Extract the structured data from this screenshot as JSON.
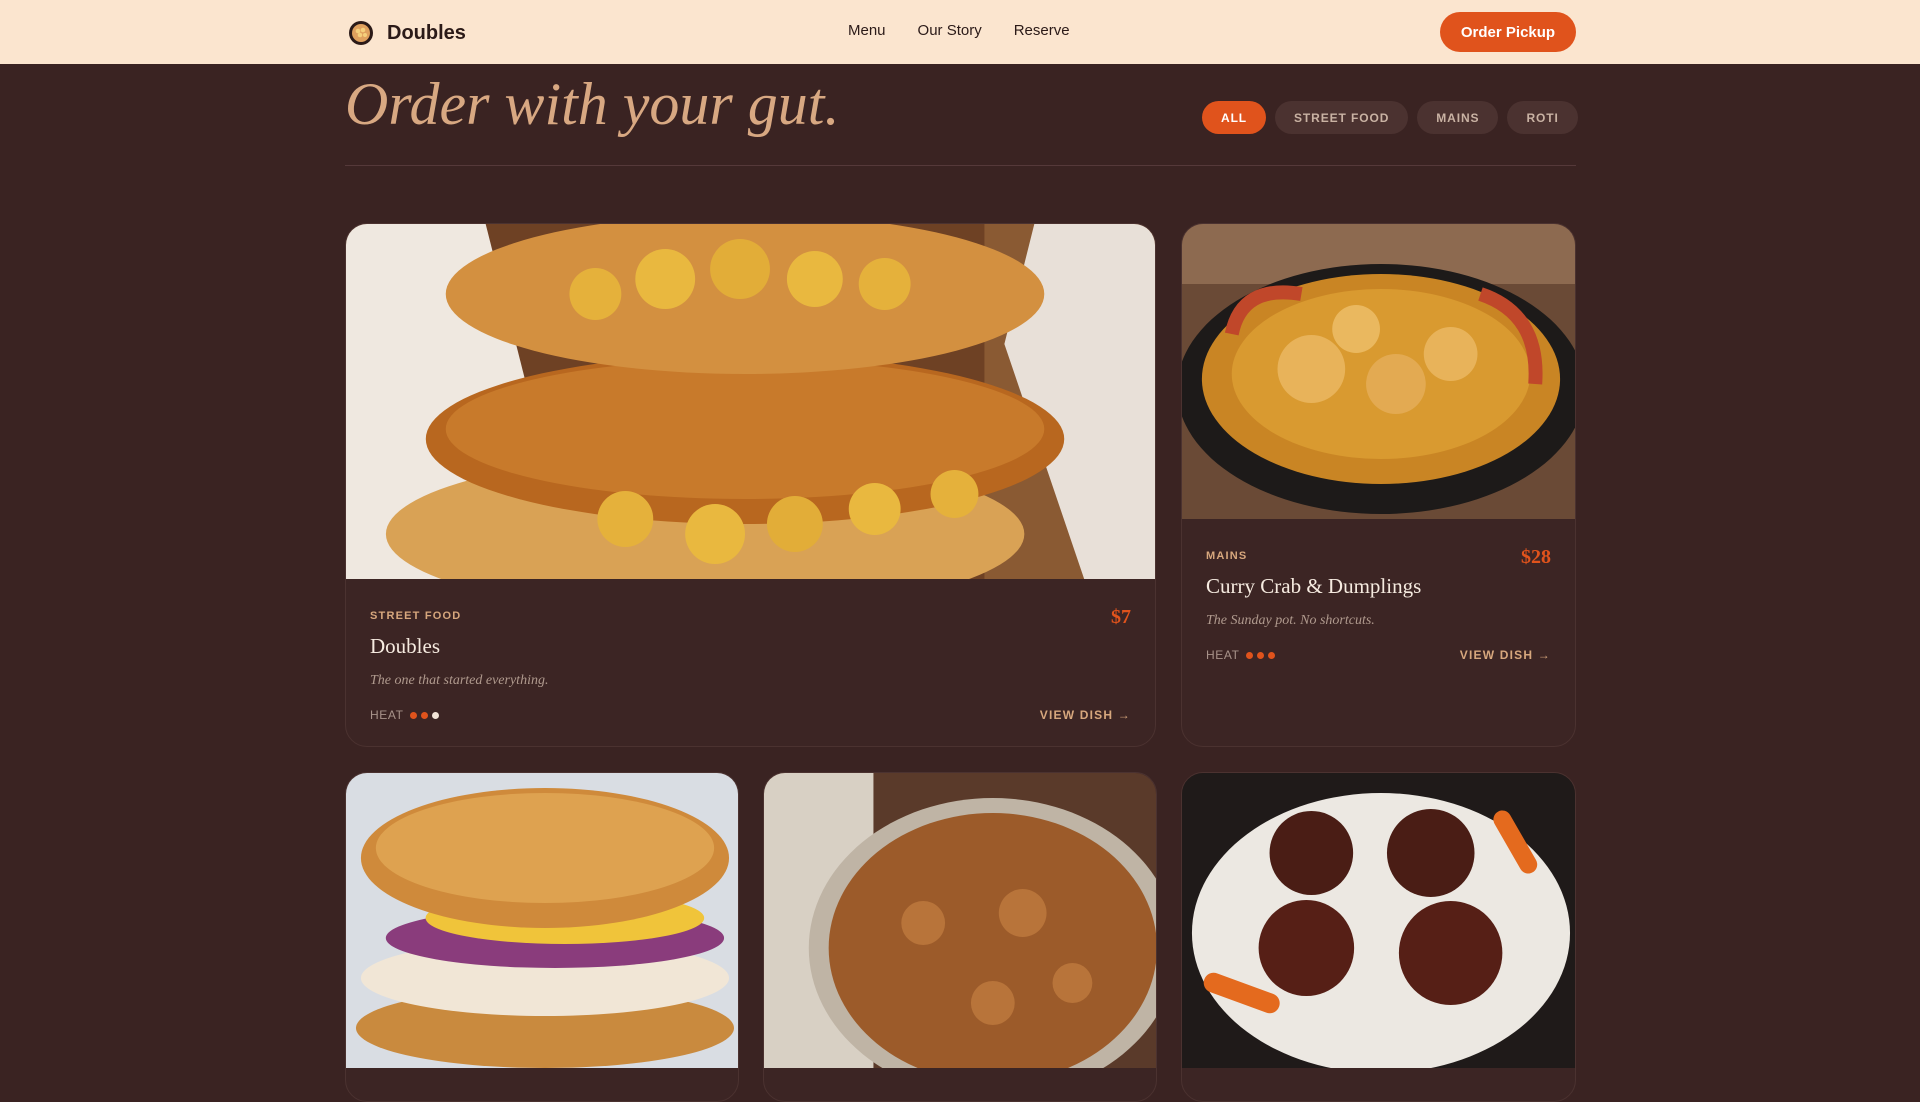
{
  "header": {
    "brand": "Doubles",
    "logo_icon": "doubles-logo-icon",
    "nav": [
      {
        "label": "Menu"
      },
      {
        "label": "Our Story"
      },
      {
        "label": "Reserve"
      }
    ],
    "cta_label": "Order Pickup"
  },
  "hero": {
    "title": "Order with your gut."
  },
  "filters": [
    {
      "label": "ALL",
      "active": true
    },
    {
      "label": "STREET FOOD",
      "active": false
    },
    {
      "label": "MAINS",
      "active": false
    },
    {
      "label": "ROTI",
      "active": false
    }
  ],
  "heat_label": "HEAT",
  "view_label": "VIEW DISH →",
  "dishes": [
    {
      "category": "STREET FOOD",
      "name": "Doubles",
      "price": "$7",
      "description": "The one that started everything.",
      "heat_level": 2,
      "heat_max": 3,
      "image": "doubles-photo"
    },
    {
      "category": "MAINS",
      "name": "Curry Crab & Dumplings",
      "price": "$28",
      "description": "The Sunday pot. No shortcuts.",
      "heat_level": 3,
      "heat_max": 3,
      "image": "curry-crab-photo"
    },
    {
      "image": "fish-sandwich-photo"
    },
    {
      "image": "pelau-rice-photo"
    },
    {
      "image": "oxtail-stew-photo"
    }
  ],
  "colors": {
    "accent": "#e0531c",
    "background": "#3a2322",
    "header_bg": "#fbe5cf",
    "card_bg": "#3c2524",
    "hero_text": "#d8a882",
    "label_tan": "#d7a77d"
  }
}
